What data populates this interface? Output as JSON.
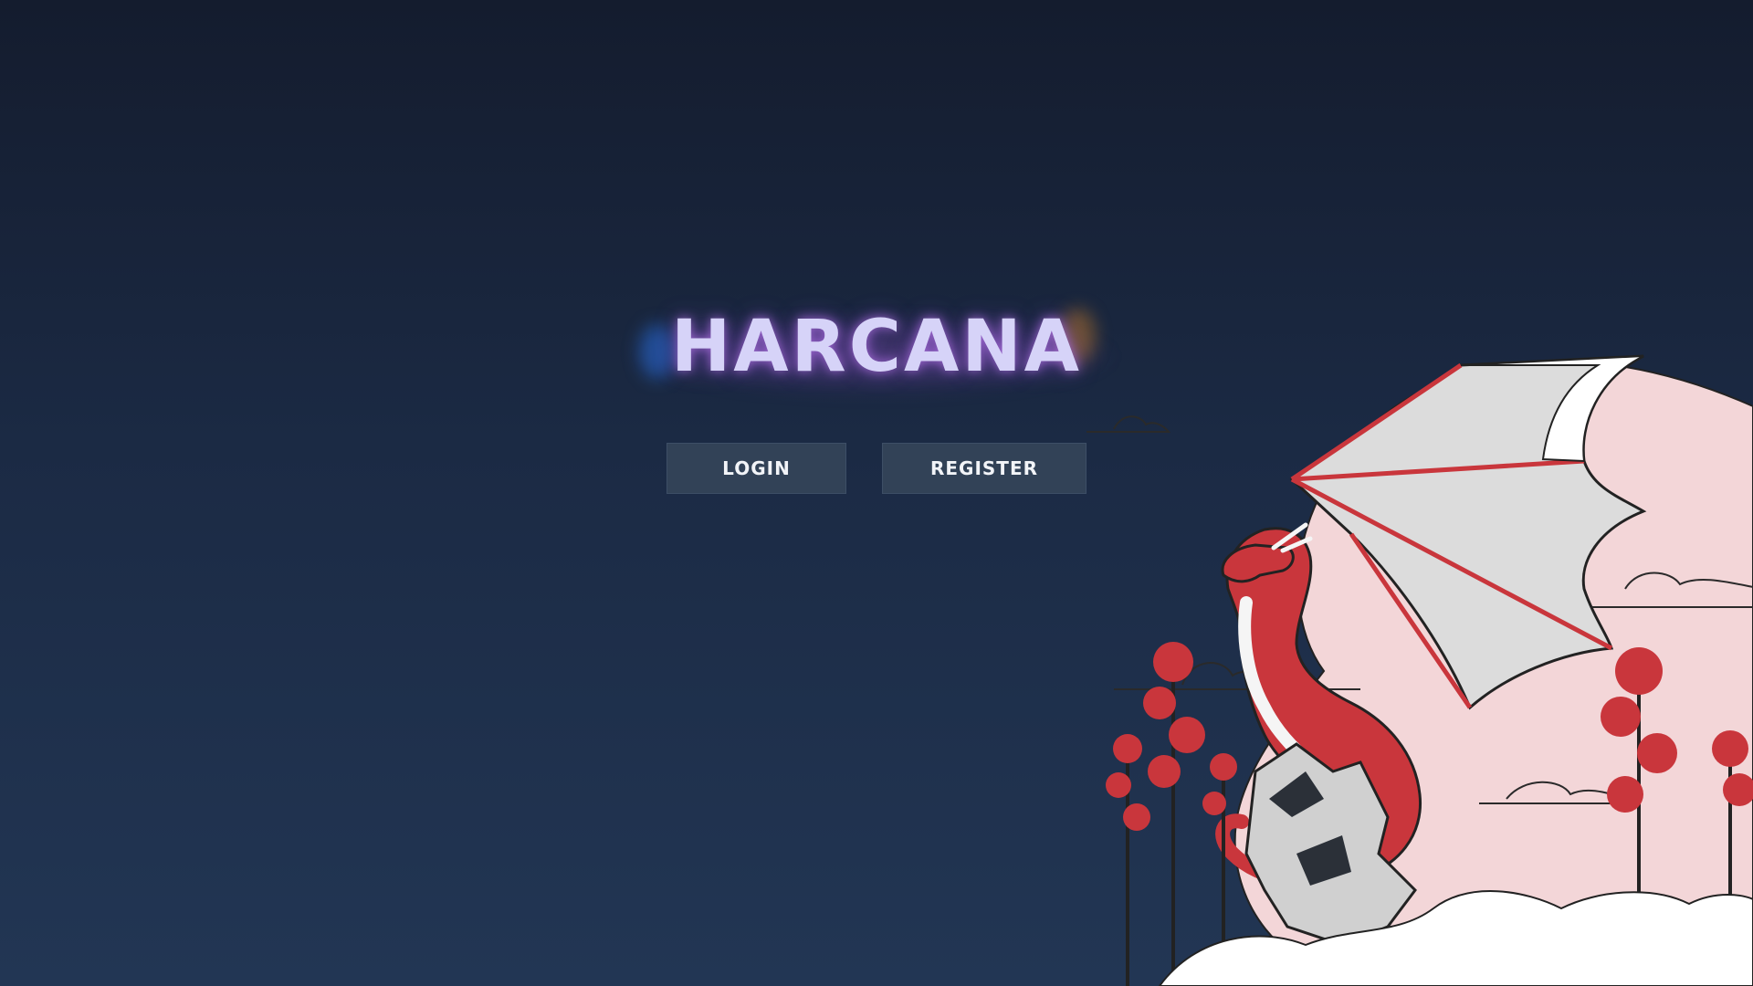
{
  "app": {
    "title": "HARCANA"
  },
  "buttons": {
    "login_label": "LOGIN",
    "register_label": "REGISTER"
  },
  "colors": {
    "background_top": "#141c2e",
    "background_bottom": "#223654",
    "button_bg": "#324257",
    "title_text": "#d6d3f8",
    "dragon_red": "#c9363c",
    "moon_pink": "#f3d6d8"
  },
  "illustration": {
    "icon": "dragon-illustration"
  }
}
